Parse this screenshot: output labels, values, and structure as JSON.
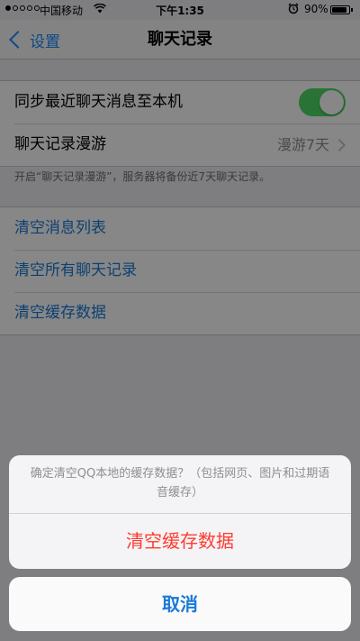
{
  "status_bar": {
    "carrier": "中国移动",
    "time": "下午1:35",
    "battery": "90%",
    "battery_level": 0.9
  },
  "nav": {
    "back_label": "设置",
    "title": "聊天记录"
  },
  "settings": {
    "sync_label": "同步最近聊天消息至本机",
    "sync_enabled": true,
    "roaming_label": "聊天记录漫游",
    "roaming_value": "漫游7天",
    "roaming_footer": "开启“聊天记录漫游”，服务器将备份近7天聊天记录。"
  },
  "actions": {
    "clear_message_list": "清空消息列表",
    "clear_all_chats": "清空所有聊天记录",
    "clear_cache": "清空缓存数据"
  },
  "action_sheet": {
    "message": "确定清空QQ本地的缓存数据？（包括网页、图片和过期语音缓存）",
    "destructive_label": "清空缓存数据",
    "cancel_label": "取消"
  },
  "colors": {
    "accent": "#1a7ad8",
    "switch_on": "#4cd964",
    "destructive": "#ff3b30"
  },
  "icons": [
    "signal-dots-icon",
    "wifi-icon",
    "alarm-icon",
    "battery-icon",
    "chevron-left-icon",
    "chevron-right-icon",
    "toggle-switch"
  ]
}
